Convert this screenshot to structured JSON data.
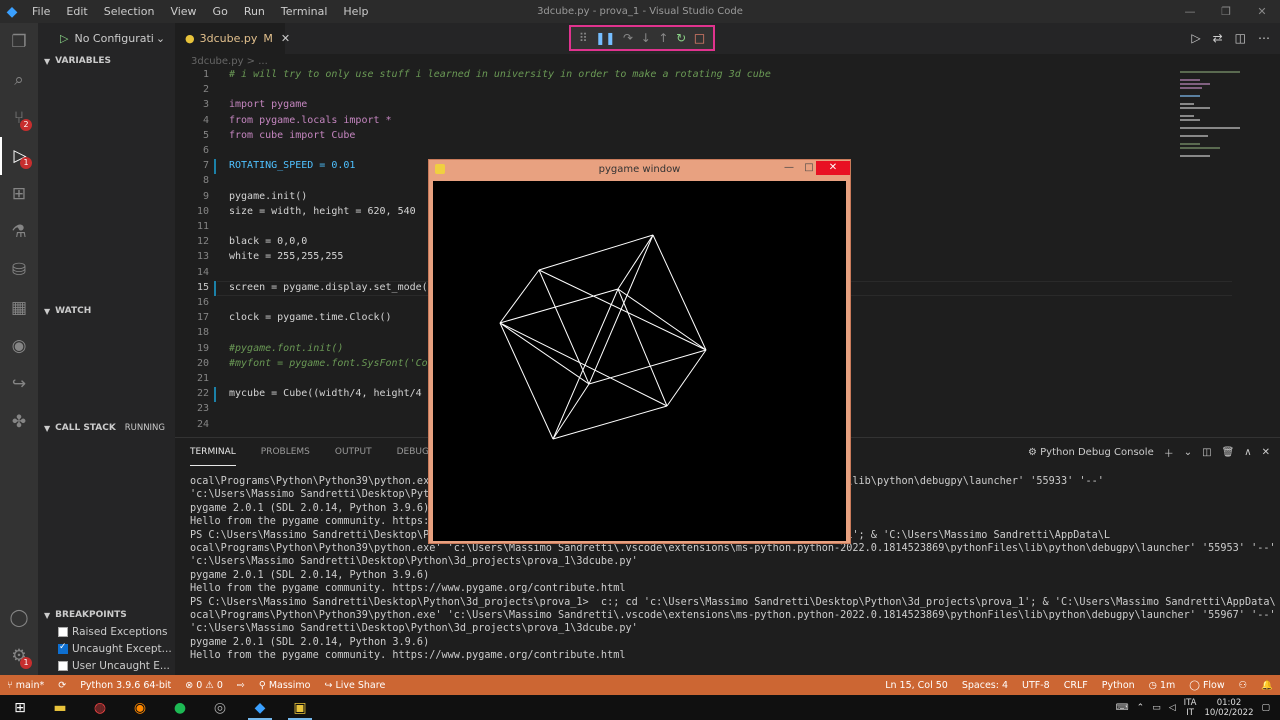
{
  "titlebar": {
    "menu": [
      "File",
      "Edit",
      "Selection",
      "View",
      "Go",
      "Run",
      "Terminal",
      "Help"
    ],
    "title": "3dcube.py - prova_1 - Visual Studio Code"
  },
  "sidebar": {
    "run_config": "No Configurati",
    "variables": "VARIABLES",
    "watch": "WATCH",
    "call_stack": "CALL STACK",
    "call_stack_state": "RUNNING",
    "breakpoints": "BREAKPOINTS",
    "bp_items": [
      {
        "label": "Raised Exceptions",
        "checked": false
      },
      {
        "label": "Uncaught Except...",
        "checked": true
      },
      {
        "label": "User Uncaught E...",
        "checked": false
      }
    ]
  },
  "activity_badges": {
    "scm": "2",
    "debug": "1",
    "settings": "1"
  },
  "editor": {
    "tab_label": "3dcube.py",
    "tab_mark": "M",
    "breadcrumb": "3dcube.py > ..."
  },
  "code_lines": [
    {
      "n": "1",
      "t": "# i will try to only use stuff i learned in university in order to make a rotating 3d cube"
    },
    {
      "n": "2",
      "t": ""
    },
    {
      "n": "3",
      "t": "import pygame"
    },
    {
      "n": "4",
      "t": "from pygame.locals import *"
    },
    {
      "n": "5",
      "t": "from cube import Cube"
    },
    {
      "n": "6",
      "t": ""
    },
    {
      "n": "7",
      "t": "ROTATING_SPEED = 0.01"
    },
    {
      "n": "8",
      "t": ""
    },
    {
      "n": "9",
      "t": "pygame.init()"
    },
    {
      "n": "10",
      "t": "size = width, height = 620, 540"
    },
    {
      "n": "11",
      "t": ""
    },
    {
      "n": "12",
      "t": "black = 0,0,0"
    },
    {
      "n": "13",
      "t": "white = 255,255,255"
    },
    {
      "n": "14",
      "t": ""
    },
    {
      "n": "15",
      "t": "screen = pygame.display.set_mode("
    },
    {
      "n": "16",
      "t": ""
    },
    {
      "n": "17",
      "t": "clock = pygame.time.Clock()"
    },
    {
      "n": "18",
      "t": ""
    },
    {
      "n": "19",
      "t": "#pygame.font.init()"
    },
    {
      "n": "20",
      "t": "#myfont = pygame.font.SysFont('Co"
    },
    {
      "n": "21",
      "t": ""
    },
    {
      "n": "22",
      "t": "mycube = Cube((width/4, height/4"
    },
    {
      "n": "23",
      "t": ""
    },
    {
      "n": "24",
      "t": ""
    }
  ],
  "panel": {
    "tabs": [
      "TERMINAL",
      "PROBLEMS",
      "OUTPUT",
      "DEBUG CONSOLE"
    ],
    "console_label": "Python Debug Console"
  },
  "terminal_lines": [
    "ocal\\Programs\\Python\\Python39\\python.exe                                          .0.1814523869\\pythonFiles\\lib\\python\\debugpy\\launcher' '55933' '--'",
    "'c:\\Users\\Massimo Sandretti\\Desktop\\Pyt",
    "pygame 2.0.1 (SDL 2.0.14, Python 3.9.6)",
    "Hello from the pygame community. https:/",
    "PS C:\\Users\\Massimo Sandretti\\Desktop\\Pyt                                          ython\\3d_projects\\prova_1'; & 'C:\\Users\\Massimo Sandretti\\AppData\\L",
    "ocal\\Programs\\Python\\Python39\\python.exe' 'c:\\Users\\Massimo Sandretti\\.vscode\\extensions\\ms-python.python-2022.0.1814523869\\pythonFiles\\lib\\python\\debugpy\\launcher' '55953' '--'",
    "'c:\\Users\\Massimo Sandretti\\Desktop\\Python\\3d_projects\\prova_1\\3dcube.py'",
    "pygame 2.0.1 (SDL 2.0.14, Python 3.9.6)",
    "Hello from the pygame community. https://www.pygame.org/contribute.html",
    "PS C:\\Users\\Massimo Sandretti\\Desktop\\Python\\3d_projects\\prova_1>  c:; cd 'c:\\Users\\Massimo Sandretti\\Desktop\\Python\\3d_projects\\prova_1'; & 'C:\\Users\\Massimo Sandretti\\AppData\\L",
    "ocal\\Programs\\Python\\Python39\\python.exe' 'c:\\Users\\Massimo Sandretti\\.vscode\\extensions\\ms-python.python-2022.0.1814523869\\pythonFiles\\lib\\python\\debugpy\\launcher' '55967' '--'",
    "'c:\\Users\\Massimo Sandretti\\Desktop\\Python\\3d_projects\\prova_1\\3dcube.py'",
    "pygame 2.0.1 (SDL 2.0.14, Python 3.9.6)",
    "Hello from the pygame community. https://www.pygame.org/contribute.html"
  ],
  "pygame": {
    "title": "pygame window"
  },
  "statusbar": {
    "branch": "main*",
    "interpreter": "Python 3.9.6 64-bit",
    "problems": "⊗ 0 ⚠ 0",
    "user": "Massimo",
    "liveshare": "Live Share",
    "position": "Ln 15, Col 50",
    "spaces": "Spaces: 4",
    "encoding": "UTF-8",
    "eol": "CRLF",
    "language": "Python",
    "time_est": "1m",
    "flow": "Flow"
  },
  "taskbar": {
    "lang": "ITA",
    "region": "IT",
    "time": "01:02",
    "date": "10/02/2022"
  },
  "colors": {
    "statusbar": "#cc6633",
    "debug_toolbar_border": "#e0338e",
    "pygame_frame": "#e8a180"
  }
}
